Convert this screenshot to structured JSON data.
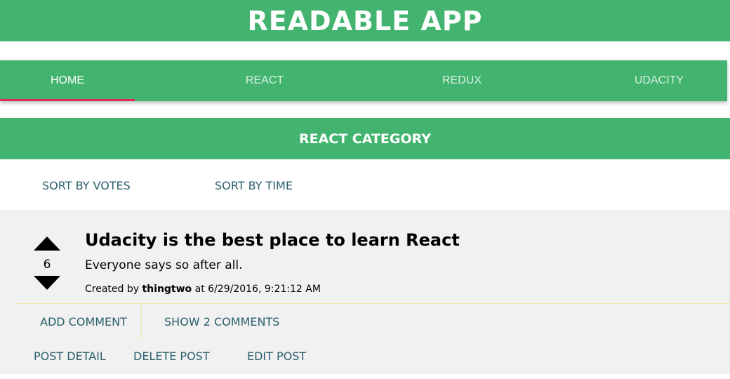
{
  "header": {
    "title": "READABLE APP"
  },
  "nav": {
    "tabs": [
      {
        "label": "HOME",
        "active": true
      },
      {
        "label": "REACT",
        "active": false
      },
      {
        "label": "REDUX",
        "active": false
      },
      {
        "label": "UDACITY",
        "active": false
      }
    ]
  },
  "category": {
    "title": "REACT CATEGORY"
  },
  "sort": {
    "by_votes": "SORT BY VOTES",
    "by_time": "SORT BY TIME"
  },
  "post": {
    "title": "Udacity is the best place to learn React",
    "body": "Everyone says so after all.",
    "score": "6",
    "meta_prefix": "Created by",
    "author": "thingtwo",
    "meta_at": "at",
    "timestamp": "6/29/2016, 9:21:12 AM",
    "actions": {
      "add_comment": "ADD COMMENT",
      "show_comments": "SHOW 2 COMMENTS",
      "post_detail": "POST DETAIL",
      "delete_post": "DELETE POST",
      "edit_post": "EDIT POST"
    }
  },
  "colors": {
    "brand": "#43b46f",
    "tab_indicator": "#e0245e",
    "link": "#2a5f6a",
    "card_bg": "#f1f1f1",
    "divider": "#efe6a8"
  },
  "icons": {
    "upvote": "arrow-up-icon",
    "downvote": "arrow-down-icon"
  }
}
